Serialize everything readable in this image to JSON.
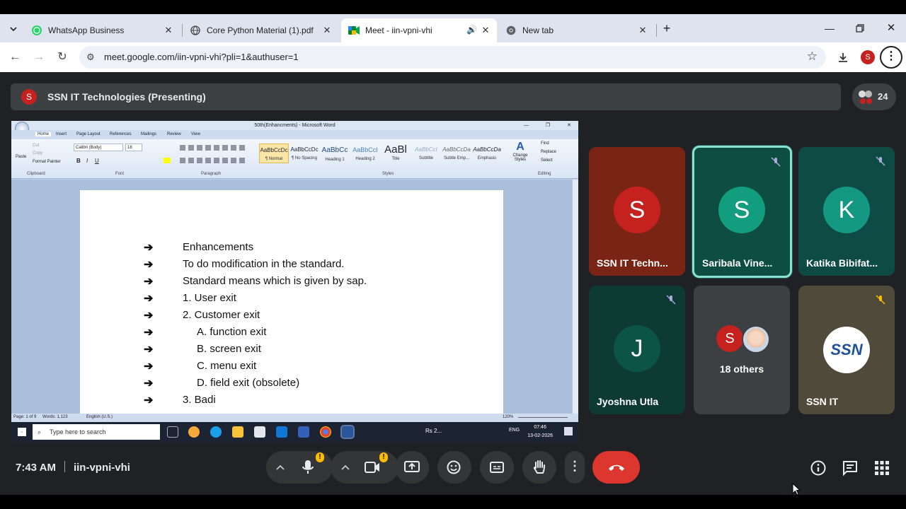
{
  "browser": {
    "tabs": [
      {
        "title": "WhatsApp Business",
        "icon": "whatsapp-icon"
      },
      {
        "title": "Core Python Material (1).pdf",
        "icon": "globe-icon"
      },
      {
        "title": "Meet - iin-vpni-vhi",
        "icon": "meet-icon",
        "active": true
      },
      {
        "title": "New tab",
        "icon": "chrome-icon"
      }
    ],
    "url": "meet.google.com/iin-vpni-vhi?pli=1&authuser=1",
    "profile_initial": "S"
  },
  "meet": {
    "presenter_initial": "S",
    "presenter_label": "SSN IT Technologies (Presenting)",
    "participant_count": "24",
    "time": "7:43 AM",
    "meeting_code": "iin-vpni-vhi",
    "participants": [
      {
        "initial": "S",
        "name": "SSN IT Techn...",
        "color": "#c5221f",
        "bg": "#7a2415"
      },
      {
        "initial": "S",
        "name": "Saribala Vine...",
        "color": "#129e7e",
        "bg": "#0e4d42"
      },
      {
        "initial": "K",
        "name": "Katika Bibifat...",
        "color": "#149882",
        "bg": "#0e4b44"
      },
      {
        "initial": "J",
        "name": "Jyoshna Utla",
        "color": "#0b5446",
        "bg": "#0d3b33"
      },
      {
        "initial": "S",
        "name": "18 others"
      },
      {
        "name": "SSN IT",
        "logo": "SSN"
      }
    ]
  },
  "word": {
    "title": "50th(Enhancments) - Microsoft Word",
    "tabs": [
      "Home",
      "Insert",
      "Page Layout",
      "References",
      "Mailings",
      "Review",
      "View"
    ],
    "font_name": "Calibri (Body)",
    "font_size": "18",
    "clipboard": [
      "Cut",
      "Copy",
      "Format Painter",
      "Paste"
    ],
    "groups": [
      "Clipboard",
      "Font",
      "Paragraph",
      "Styles",
      "Editing"
    ],
    "styles": [
      {
        "sample": "AaBbCcDc",
        "name": "¶ Normal"
      },
      {
        "sample": "AaBbCcDc",
        "name": "¶ No Spacing"
      },
      {
        "sample": "AaBbCc",
        "name": "Heading 1"
      },
      {
        "sample": "AaBbCcI",
        "name": "Heading 2"
      },
      {
        "sample": "AaBl",
        "name": "Title"
      },
      {
        "sample": "AaBbCcI",
        "name": "Subtitle"
      },
      {
        "sample": "AaBbCcDa",
        "name": "Subtle Emp..."
      },
      {
        "sample": "AaBbCcDa",
        "name": "Emphasis"
      }
    ],
    "change_styles": "Change Styles",
    "editing": [
      "Find",
      "Replace",
      "Select"
    ],
    "lines": [
      {
        "text": "Enhancements",
        "indent": 0
      },
      {
        "text": "To do modification in the standard.",
        "indent": 0
      },
      {
        "text": "Standard means which is given by sap.",
        "indent": 0
      },
      {
        "text": "1. User exit",
        "indent": 0
      },
      {
        "text": "2. Customer exit",
        "indent": 0
      },
      {
        "text": "A. function exit",
        "indent": 1
      },
      {
        "text": "B. screen exit",
        "indent": 1
      },
      {
        "text": "C. menu exit",
        "indent": 1
      },
      {
        "text": "D. field exit (obsolete)",
        "indent": 1
      },
      {
        "text": "3. Badi",
        "indent": 0
      }
    ],
    "status": {
      "page": "Page: 1 of 9",
      "words": "Words: 1,123",
      "language": "English (U.S.)",
      "zoom": "120%"
    },
    "taskbar": {
      "search_placeholder": "Type here to search",
      "tray_app": "Rs 2...",
      "lang": "ENG",
      "clock_time": "07:46",
      "clock_date": "13-02-2026"
    }
  }
}
